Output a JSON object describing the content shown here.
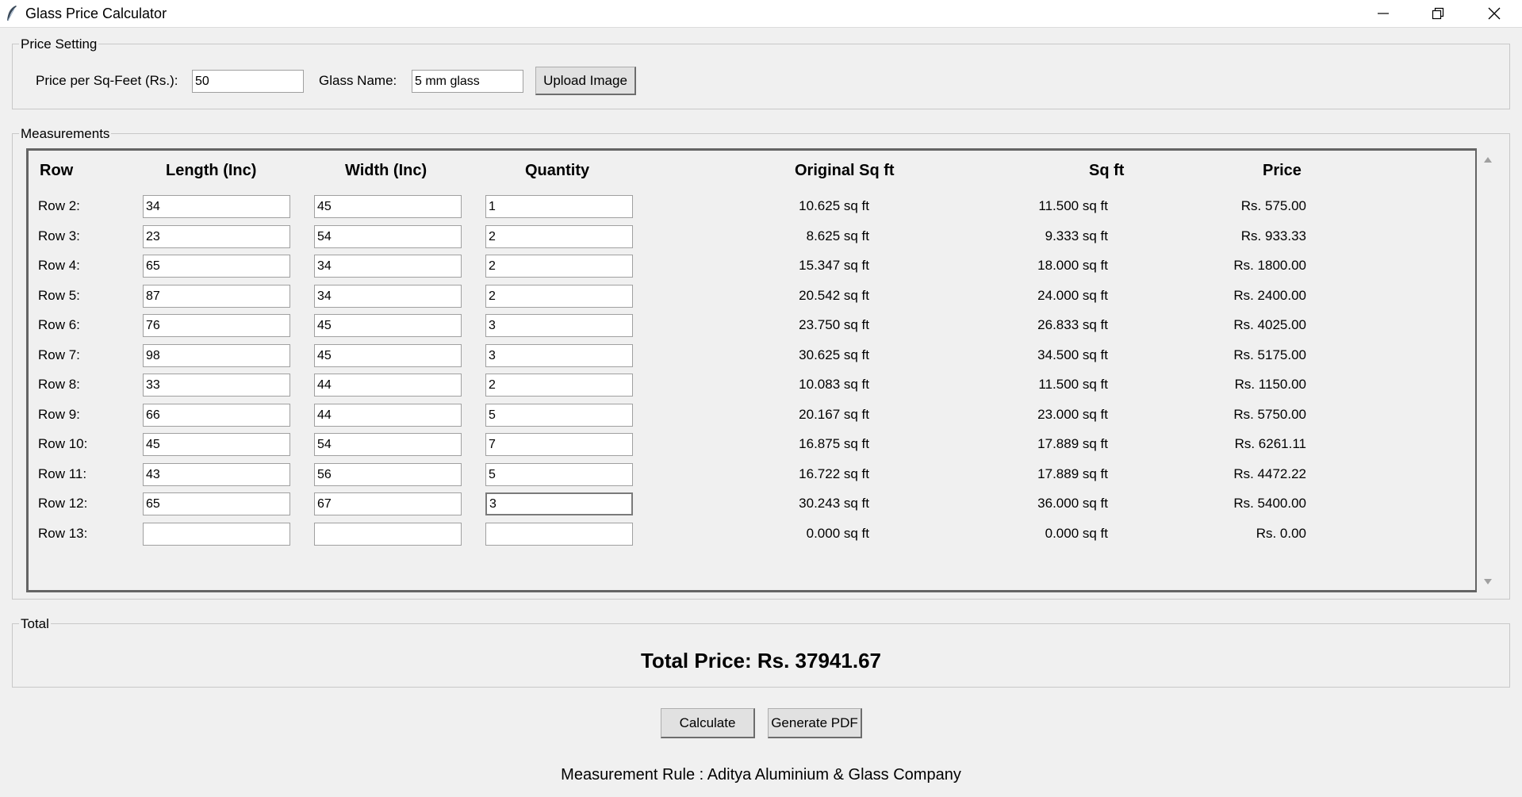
{
  "window": {
    "title": "Glass Price Calculator"
  },
  "price_setting": {
    "group_label": "Price Setting",
    "price_label": "Price per Sq-Feet (Rs.):",
    "price_value": "50",
    "glass_label": "Glass Name:",
    "glass_value": "5 mm glass",
    "upload_label": "Upload Image"
  },
  "measurements": {
    "group_label": "Measurements",
    "headers": {
      "row": "Row",
      "length": "Length (Inc)",
      "width": "Width (Inc)",
      "quantity": "Quantity",
      "original": "Original Sq ft",
      "sqft": "Sq ft",
      "price": "Price"
    },
    "rows": [
      {
        "label": "Row 2:",
        "length": "34",
        "width": "45",
        "quantity": "1",
        "original": "10.625 sq ft",
        "sqft": "11.500 sq ft",
        "price": "Rs. 575.00"
      },
      {
        "label": "Row 3:",
        "length": "23",
        "width": "54",
        "quantity": "2",
        "original": "8.625 sq ft",
        "sqft": "9.333 sq ft",
        "price": "Rs. 933.33"
      },
      {
        "label": "Row 4:",
        "length": "65",
        "width": "34",
        "quantity": "2",
        "original": "15.347 sq ft",
        "sqft": "18.000 sq ft",
        "price": "Rs. 1800.00"
      },
      {
        "label": "Row 5:",
        "length": "87",
        "width": "34",
        "quantity": "2",
        "original": "20.542 sq ft",
        "sqft": "24.000 sq ft",
        "price": "Rs. 2400.00"
      },
      {
        "label": "Row 6:",
        "length": "76",
        "width": "45",
        "quantity": "3",
        "original": "23.750 sq ft",
        "sqft": "26.833 sq ft",
        "price": "Rs. 4025.00"
      },
      {
        "label": "Row 7:",
        "length": "98",
        "width": "45",
        "quantity": "3",
        "original": "30.625 sq ft",
        "sqft": "34.500 sq ft",
        "price": "Rs. 5175.00"
      },
      {
        "label": "Row 8:",
        "length": "33",
        "width": "44",
        "quantity": "2",
        "original": "10.083 sq ft",
        "sqft": "11.500 sq ft",
        "price": "Rs. 1150.00"
      },
      {
        "label": "Row 9:",
        "length": "66",
        "width": "44",
        "quantity": "5",
        "original": "20.167 sq ft",
        "sqft": "23.000 sq ft",
        "price": "Rs. 5750.00"
      },
      {
        "label": "Row 10:",
        "length": "45",
        "width": "54",
        "quantity": "7",
        "original": "16.875 sq ft",
        "sqft": "17.889 sq ft",
        "price": "Rs. 6261.11"
      },
      {
        "label": "Row 11:",
        "length": "43",
        "width": "56",
        "quantity": "5",
        "original": "16.722 sq ft",
        "sqft": "17.889 sq ft",
        "price": "Rs. 4472.22"
      },
      {
        "label": "Row 12:",
        "length": "65",
        "width": "67",
        "quantity": "3",
        "original": "30.243 sq ft",
        "sqft": "36.000 sq ft",
        "price": "Rs. 5400.00"
      },
      {
        "label": "Row 13:",
        "length": "",
        "width": "",
        "quantity": "",
        "original": "0.000 sq ft",
        "sqft": "0.000 sq ft",
        "price": "Rs. 0.00"
      }
    ]
  },
  "total": {
    "group_label": "Total",
    "text": "Total Price: Rs. 37941.67"
  },
  "actions": {
    "calculate_label": "Calculate",
    "pdf_label": "Generate PDF"
  },
  "footer": {
    "text": "Measurement Rule : Aditya Aluminium & Glass Company"
  }
}
